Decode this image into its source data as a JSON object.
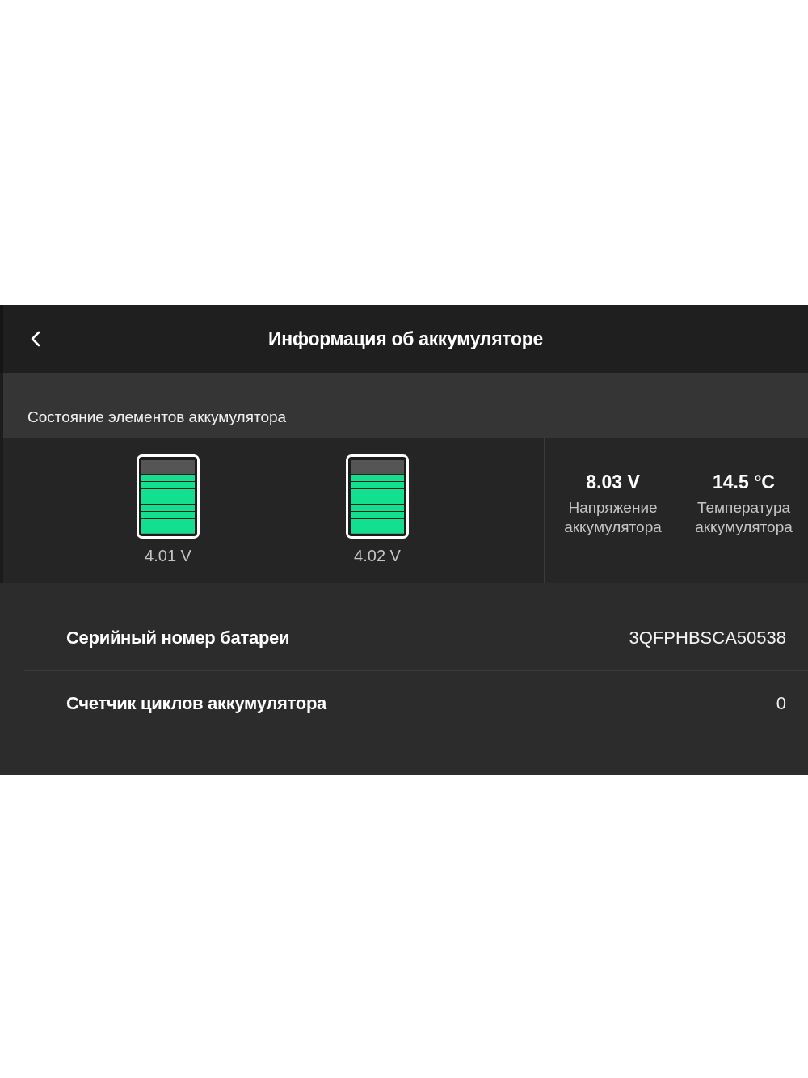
{
  "header": {
    "title": "Информация об аккумуляторе"
  },
  "cells_section": {
    "title": "Состояние элементов аккумулятора",
    "cells": [
      {
        "voltage": "4.01 V",
        "level": 0.8
      },
      {
        "voltage": "4.02 V",
        "level": 0.8
      }
    ],
    "stats": [
      {
        "value": "8.03 V",
        "label": "Напряжение аккумулятора"
      },
      {
        "value": "14.5 °C",
        "label": "Температура аккумулятора"
      }
    ]
  },
  "rows": [
    {
      "label": "Серийный номер батареи",
      "value": "3QFPHBSCA50538"
    },
    {
      "label": "Счетчик циклов аккумулятора",
      "value": "0"
    }
  ]
}
